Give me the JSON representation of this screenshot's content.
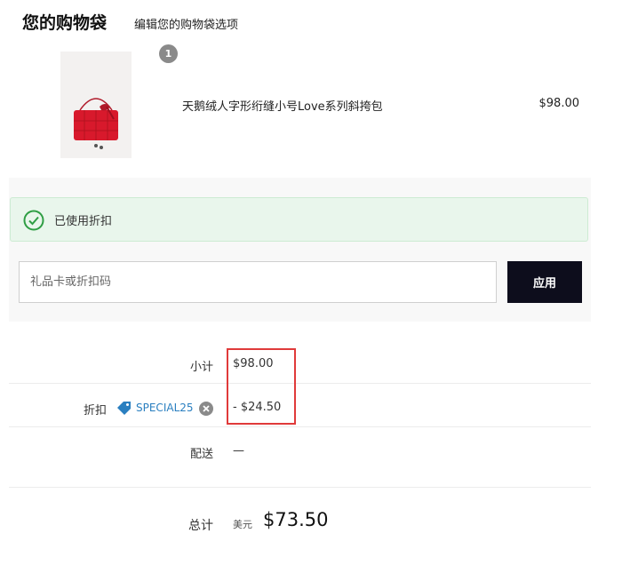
{
  "header": {
    "title": "您的购物袋",
    "edit_link": "编辑您的购物袋选项"
  },
  "item": {
    "image_icon": "red-quilted-crossbody-bag-image",
    "quantity": "1",
    "name": "天鹅绒人字形绗缝小号Love系列斜挎包",
    "price": "$98.00"
  },
  "promo": {
    "alert_icon": "check-circle-icon",
    "alert_text": "已使用折扣",
    "input_value": "",
    "input_placeholder": "礼品卡或折扣码",
    "apply_label": "应用"
  },
  "summary": {
    "subtotal_label": "小计",
    "subtotal_value": "$98.00",
    "discount_label": "折扣",
    "discount_code": "SPECIAL25",
    "discount_value": "- $24.50",
    "shipping_label": "配送",
    "shipping_value": "—",
    "total_label": "总计",
    "total_currency": "美元",
    "total_value": "$73.50"
  },
  "colors": {
    "accent_dark": "#0d0d1c",
    "success_green": "#2f9e44",
    "link_blue": "#2a7fc0",
    "highlight_red": "#e03a3a"
  }
}
